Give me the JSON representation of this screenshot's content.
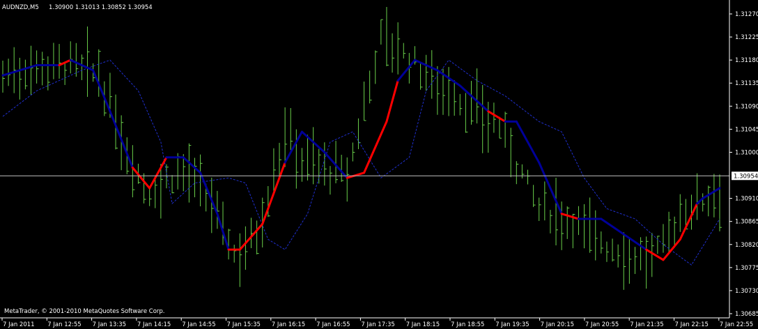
{
  "header": {
    "symbol": "AUDNZD,M5",
    "ohlc": "1.30900 1.31013 1.30852 1.30954"
  },
  "copyright": "MetaTrader, © 2001-2010 MetaQuotes Software Corp.",
  "colors": {
    "background": "#000000",
    "axis": "#ffffff",
    "bars": "#6ad04a",
    "ma_up": "#ff0000",
    "ma_down": "#000099",
    "ma_dashed": "#1f2fcf",
    "thin_line": "#e5a24a",
    "price_line": "#c0c0c0"
  },
  "chart_data": {
    "type": "line",
    "price_axis_ticks": [
      "1.31270",
      "1.31225",
      "1.31180",
      "1.31135",
      "1.31090",
      "1.31045",
      "1.31000",
      "1.30910",
      "1.30865",
      "1.30820",
      "1.30775",
      "1.30730",
      "1.30685"
    ],
    "current_price": "1.30954",
    "time_axis_ticks": [
      "7 Jan 2011",
      "7 Jan 12:55",
      "7 Jan 13:35",
      "7 Jan 14:15",
      "7 Jan 14:55",
      "7 Jan 15:35",
      "7 Jan 16:15",
      "7 Jan 16:55",
      "7 Jan 17:35",
      "7 Jan 18:15",
      "7 Jan 18:55",
      "7 Jan 19:35",
      "7 Jan 20:15",
      "7 Jan 20:55",
      "7 Jan 21:35",
      "7 Jan 22:15",
      "7 Jan 22:55"
    ],
    "ylim": [
      1.30685,
      1.3129
    ],
    "bar_count": 128,
    "bar_series_keypoints": [
      {
        "i": 0,
        "v": 1.3115
      },
      {
        "i": 6,
        "v": 1.3117
      },
      {
        "i": 12,
        "v": 1.3117
      },
      {
        "i": 17,
        "v": 1.3115
      },
      {
        "i": 22,
        "v": 1.31
      },
      {
        "i": 26,
        "v": 1.3092
      },
      {
        "i": 32,
        "v": 1.3097
      },
      {
        "i": 38,
        "v": 1.3088
      },
      {
        "i": 41,
        "v": 1.308
      },
      {
        "i": 45,
        "v": 1.3084
      },
      {
        "i": 50,
        "v": 1.3104
      },
      {
        "i": 53,
        "v": 1.3099
      },
      {
        "i": 61,
        "v": 1.3095
      },
      {
        "i": 67,
        "v": 1.3123
      },
      {
        "i": 72,
        "v": 1.3118
      },
      {
        "i": 80,
        "v": 1.3111
      },
      {
        "i": 88,
        "v": 1.3105
      },
      {
        "i": 95,
        "v": 1.3089
      },
      {
        "i": 101,
        "v": 1.3087
      },
      {
        "i": 108,
        "v": 1.3081
      },
      {
        "i": 115,
        "v": 1.3079
      },
      {
        "i": 121,
        "v": 1.3089
      },
      {
        "i": 127,
        "v": 1.3093
      }
    ],
    "ma_fast": [
      {
        "i": 0,
        "v": 1.3115,
        "c": "down"
      },
      {
        "i": 6,
        "v": 1.3117,
        "c": "down"
      },
      {
        "i": 10,
        "v": 1.3117,
        "c": "down"
      },
      {
        "i": 12,
        "v": 1.3118,
        "c": "up"
      },
      {
        "i": 16,
        "v": 1.3116,
        "c": "down"
      },
      {
        "i": 19,
        "v": 1.3108,
        "c": "down"
      },
      {
        "i": 23,
        "v": 1.3097,
        "c": "down"
      },
      {
        "i": 26,
        "v": 1.3093,
        "c": "up"
      },
      {
        "i": 29,
        "v": 1.3099,
        "c": "up"
      },
      {
        "i": 32,
        "v": 1.3099,
        "c": "down"
      },
      {
        "i": 35,
        "v": 1.3096,
        "c": "down"
      },
      {
        "i": 38,
        "v": 1.3088,
        "c": "down"
      },
      {
        "i": 40,
        "v": 1.3081,
        "c": "down"
      },
      {
        "i": 42,
        "v": 1.3081,
        "c": "up"
      },
      {
        "i": 46,
        "v": 1.3086,
        "c": "up"
      },
      {
        "i": 50,
        "v": 1.3098,
        "c": "up"
      },
      {
        "i": 53,
        "v": 1.3104,
        "c": "down"
      },
      {
        "i": 57,
        "v": 1.31,
        "c": "down"
      },
      {
        "i": 61,
        "v": 1.3095,
        "c": "down"
      },
      {
        "i": 64,
        "v": 1.3096,
        "c": "up"
      },
      {
        "i": 68,
        "v": 1.3106,
        "c": "up"
      },
      {
        "i": 70,
        "v": 1.3114,
        "c": "up"
      },
      {
        "i": 73,
        "v": 1.3118,
        "c": "down"
      },
      {
        "i": 77,
        "v": 1.3116,
        "c": "down"
      },
      {
        "i": 81,
        "v": 1.3113,
        "c": "down"
      },
      {
        "i": 86,
        "v": 1.3108,
        "c": "down"
      },
      {
        "i": 89,
        "v": 1.3106,
        "c": "up"
      },
      {
        "i": 91,
        "v": 1.3106,
        "c": "down"
      },
      {
        "i": 95,
        "v": 1.3098,
        "c": "down"
      },
      {
        "i": 99,
        "v": 1.3088,
        "c": "down"
      },
      {
        "i": 102,
        "v": 1.3087,
        "c": "up"
      },
      {
        "i": 106,
        "v": 1.3087,
        "c": "down"
      },
      {
        "i": 110,
        "v": 1.3084,
        "c": "down"
      },
      {
        "i": 114,
        "v": 1.3081,
        "c": "down"
      },
      {
        "i": 117,
        "v": 1.3079,
        "c": "up"
      },
      {
        "i": 120,
        "v": 1.3083,
        "c": "up"
      },
      {
        "i": 123,
        "v": 1.309,
        "c": "up"
      },
      {
        "i": 124,
        "v": 1.3091,
        "c": "down"
      },
      {
        "i": 127,
        "v": 1.3093,
        "c": "down"
      }
    ],
    "ma_slow": [
      {
        "i": 0,
        "v": 1.3107
      },
      {
        "i": 6,
        "v": 1.3112
      },
      {
        "i": 14,
        "v": 1.3116
      },
      {
        "i": 19,
        "v": 1.3118
      },
      {
        "i": 24,
        "v": 1.3112
      },
      {
        "i": 28,
        "v": 1.3102
      },
      {
        "i": 30,
        "v": 1.309
      },
      {
        "i": 34,
        "v": 1.3094
      },
      {
        "i": 40,
        "v": 1.3095
      },
      {
        "i": 43,
        "v": 1.3094
      },
      {
        "i": 47,
        "v": 1.3083
      },
      {
        "i": 50,
        "v": 1.3081
      },
      {
        "i": 54,
        "v": 1.3088
      },
      {
        "i": 58,
        "v": 1.3102
      },
      {
        "i": 62,
        "v": 1.3104
      },
      {
        "i": 67,
        "v": 1.3095
      },
      {
        "i": 72,
        "v": 1.3099
      },
      {
        "i": 75,
        "v": 1.3112
      },
      {
        "i": 79,
        "v": 1.3118
      },
      {
        "i": 84,
        "v": 1.3114
      },
      {
        "i": 89,
        "v": 1.3111
      },
      {
        "i": 95,
        "v": 1.3106
      },
      {
        "i": 99,
        "v": 1.3104
      },
      {
        "i": 103,
        "v": 1.3095
      },
      {
        "i": 107,
        "v": 1.3089
      },
      {
        "i": 112,
        "v": 1.3087
      },
      {
        "i": 117,
        "v": 1.3082
      },
      {
        "i": 122,
        "v": 1.3078
      },
      {
        "i": 127,
        "v": 1.3087
      }
    ]
  }
}
